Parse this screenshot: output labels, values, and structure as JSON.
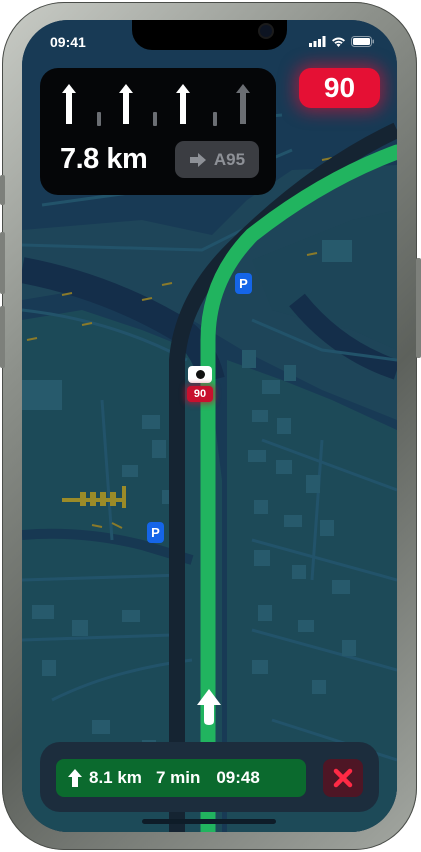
{
  "status_bar": {
    "time": "09:41"
  },
  "lane_guidance": {
    "lanes": [
      {
        "direction": "straight",
        "recommended": true
      },
      {
        "direction": "straight",
        "recommended": true
      },
      {
        "direction": "straight",
        "recommended": true
      },
      {
        "direction": "straight",
        "recommended": false
      }
    ],
    "distance": "7.8 km",
    "next_road": "A95",
    "next_road_icon": "arrow-right-icon"
  },
  "speed_limit": "90",
  "map": {
    "speed_camera_limit": "90",
    "parking_label": "P",
    "route_color": "#21b45f",
    "speed_color": "#e51034"
  },
  "trip": {
    "distance": "8.1 km",
    "duration": "7 min",
    "arrival": "09:48",
    "icon": "turn-arrow-icon"
  },
  "end_navigation_icon": "close-icon"
}
